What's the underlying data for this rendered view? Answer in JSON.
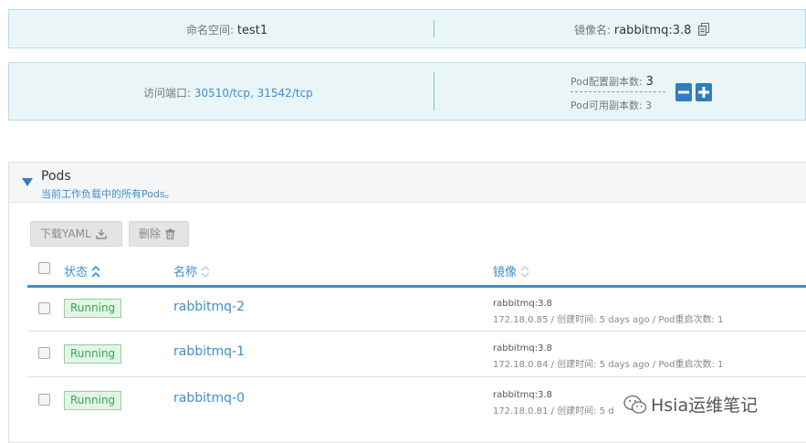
{
  "namespace": {
    "label": "命名空间:",
    "value": "test1"
  },
  "image": {
    "label": "镜像名:",
    "value": "rabbitmq:3.8"
  },
  "ports": {
    "label": "访问端口:",
    "value": "30510/tcp, 31542/tcp"
  },
  "replicas": {
    "config_label": "Pod配置副本数:",
    "config_value": "3",
    "available_label": "Pod可用副本数:",
    "available_value": "3"
  },
  "pods": {
    "title": "Pods",
    "subtitle": "当前工作负载中的所有Pods。",
    "download_label": "下载YAML",
    "delete_label": "删除",
    "columns": {
      "status": "状态",
      "name": "名称",
      "image": "镜像"
    },
    "rows": [
      {
        "status": "Running",
        "name": "rabbitmq-2",
        "image": "rabbitmq:3.8",
        "detail": "172.18.0.85 / 创建时间: 5 days ago / Pod重启次数: 1"
      },
      {
        "status": "Running",
        "name": "rabbitmq-1",
        "image": "rabbitmq:3.8",
        "detail": "172.18.0.84 / 创建时间: 5 days ago / Pod重启次数: 1"
      },
      {
        "status": "Running",
        "name": "rabbitmq-0",
        "image": "rabbitmq:3.8",
        "detail": "172.18.0.81 / 创建时间: 5 d"
      }
    ]
  },
  "watermark": "Hsia运维笔记",
  "colors": {
    "accent": "#3d8fd1",
    "running_bg": "#e3f5e6",
    "running_border": "#8fd09f",
    "info_bg": "#eaf5f7"
  }
}
